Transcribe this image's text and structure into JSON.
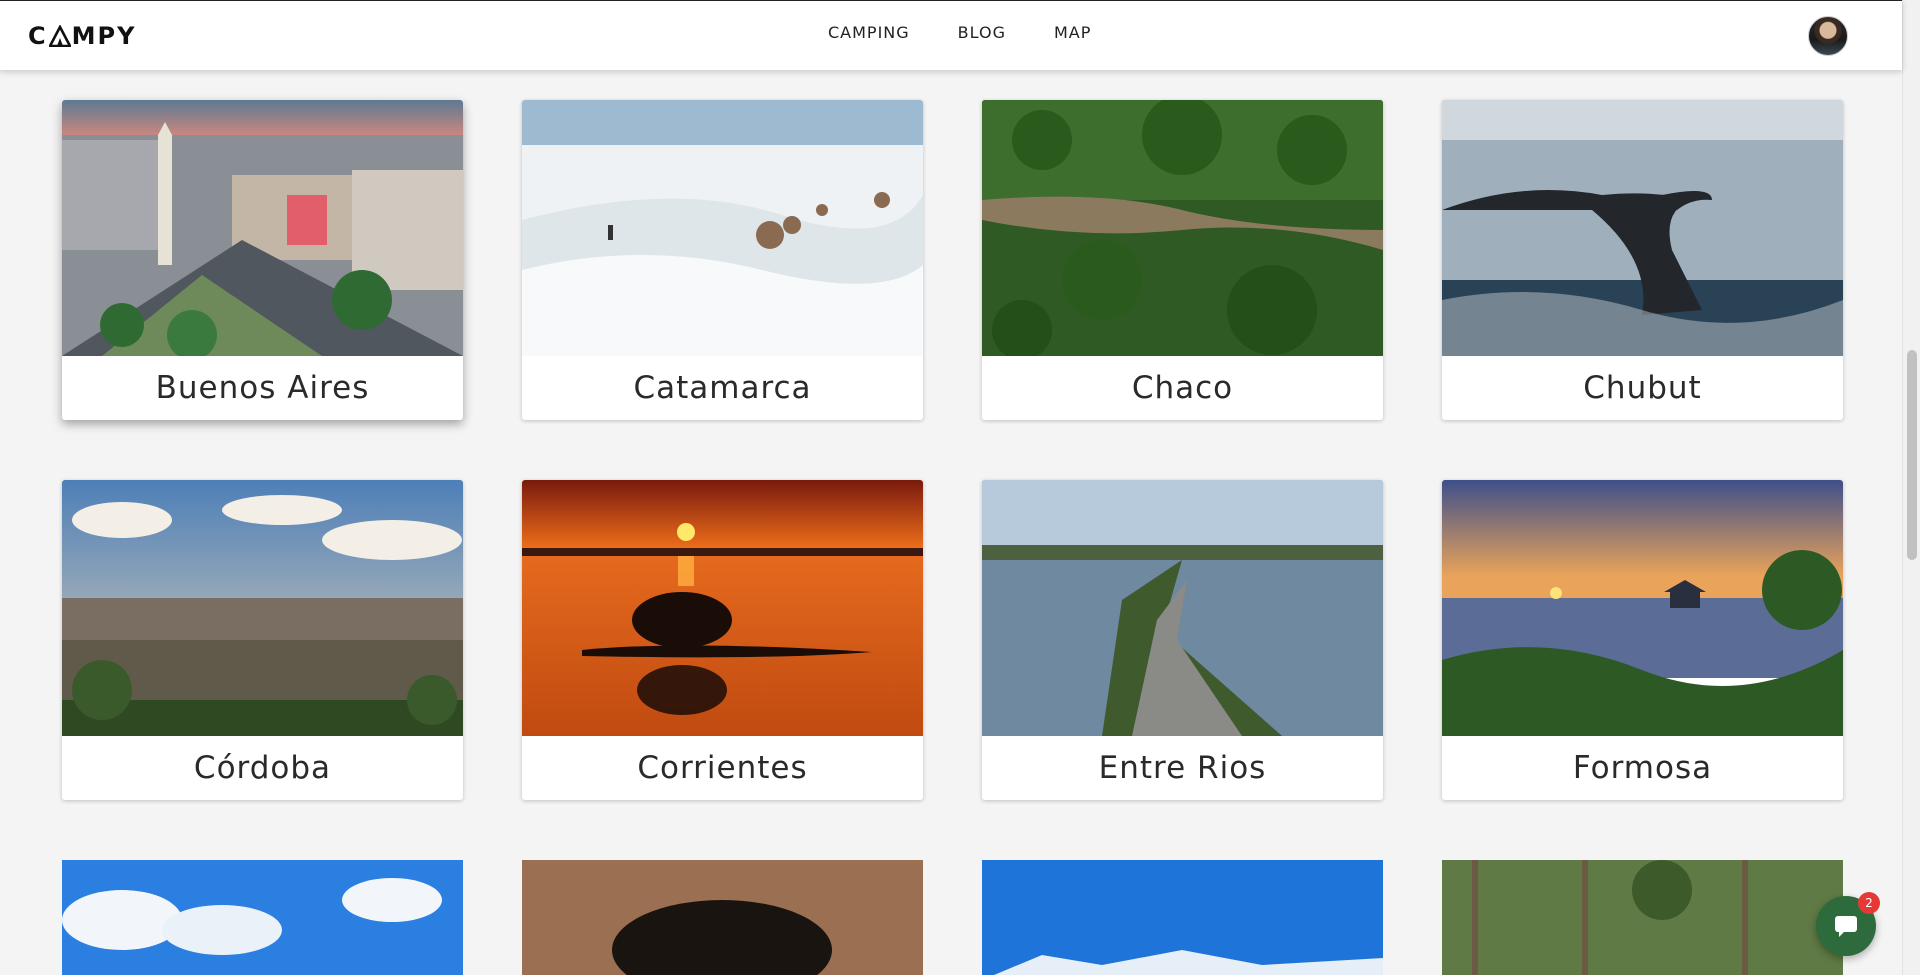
{
  "brand": {
    "logo_text_left": "C",
    "logo_text_right": "MPY"
  },
  "nav": {
    "items": [
      "CAMPING",
      "BLOG",
      "MAP"
    ]
  },
  "provinces": [
    {
      "name": "Buenos Aires"
    },
    {
      "name": "Catamarca"
    },
    {
      "name": "Chaco"
    },
    {
      "name": "Chubut"
    },
    {
      "name": "Córdoba"
    },
    {
      "name": "Corrientes"
    },
    {
      "name": "Entre Rios"
    },
    {
      "name": "Formosa"
    }
  ],
  "chat": {
    "badge_count": "2"
  },
  "colors": {
    "accent": "#2e6b3c",
    "badge": "#e53935"
  }
}
